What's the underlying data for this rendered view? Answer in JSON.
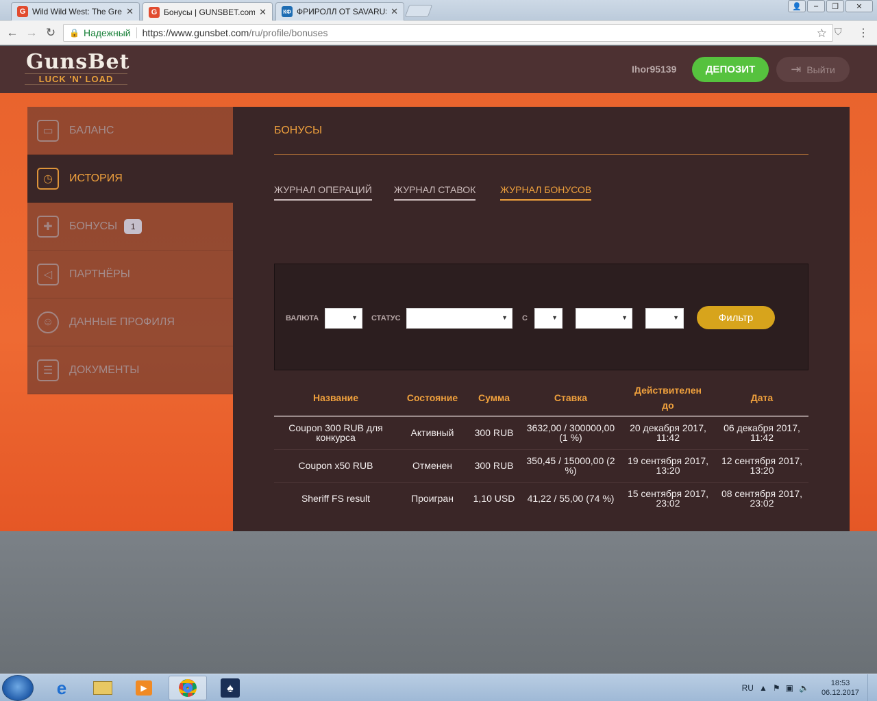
{
  "browser": {
    "tabs": [
      {
        "title": "Wild Wild West: The Gre",
        "favicon": "G",
        "favicon_color": "#e14b2f"
      },
      {
        "title": "Бонусы | GUNSBET.com",
        "favicon": "G",
        "favicon_color": "#e14b2f"
      },
      {
        "title": "ФРИРОЛЛ ОТ SAVARUS",
        "favicon": "КФ",
        "favicon_color": "#1e6db3"
      }
    ],
    "secure_label": "Надежный",
    "url_host": "https://www.gunsbet.com",
    "url_path": "/ru/profile/bonuses"
  },
  "header": {
    "logo_main": "GunsBet",
    "logo_sub": "LUCK 'N' LOAD",
    "username": "Ihor95139",
    "deposit_label": "ДЕПОЗИТ",
    "logout_label": "Выйти"
  },
  "sidebar": {
    "items": [
      {
        "label": "БАЛАНС",
        "icon": "wallet-icon"
      },
      {
        "label": "ИСТОРИЯ",
        "icon": "calendar-clock-icon"
      },
      {
        "label": "БОНУСЫ",
        "icon": "gift-icon",
        "badge": "1"
      },
      {
        "label": "ПАРТНЁРЫ",
        "icon": "megaphone-icon"
      },
      {
        "label": "ДАННЫЕ ПРОФИЛЯ",
        "icon": "user-icon"
      },
      {
        "label": "ДОКУМЕНТЫ",
        "icon": "id-card-icon"
      }
    ]
  },
  "main": {
    "title": "БОНУСЫ",
    "tabs": [
      {
        "label": "ЖУРНАЛ ОПЕРАЦИЙ"
      },
      {
        "label": "ЖУРНАЛ СТАВОК"
      },
      {
        "label": "ЖУРНАЛ БОНУСОВ"
      }
    ]
  },
  "filter": {
    "currency_label": "ВАЛЮТА",
    "status_label": "СТАТУС",
    "from_label": "С",
    "button_label": "Фильтр"
  },
  "table": {
    "headers": [
      "Название",
      "Состояние",
      "Сумма",
      "Ставка",
      "Действителен до",
      "Дата"
    ],
    "rows": [
      [
        "Coupon 300 RUB для конкурса",
        "Активный",
        "300 RUB",
        "3632,00 / 300000,00 (1 %)",
        "20 декабря 2017, 11:42",
        "06 декабря 2017, 11:42"
      ],
      [
        "Coupon x50 RUB",
        "Отменен",
        "300 RUB",
        "350,45 / 15000,00 (2 %)",
        "19 сентября 2017, 13:20",
        "12 сентября 2017, 13:20"
      ],
      [
        "Sheriff FS result",
        "Проигран",
        "1,10 USD",
        "41,22 / 55,00 (74 %)",
        "15 сентября 2017, 23:02",
        "08 сентября 2017, 23:02"
      ]
    ]
  },
  "taskbar": {
    "lang": "RU",
    "time": "18:53",
    "date": "06.12.2017"
  },
  "colors": {
    "accent": "#f0a13d",
    "deposit": "#56c23e",
    "filter_button": "#d7a41c",
    "panel": "#3a2627"
  }
}
